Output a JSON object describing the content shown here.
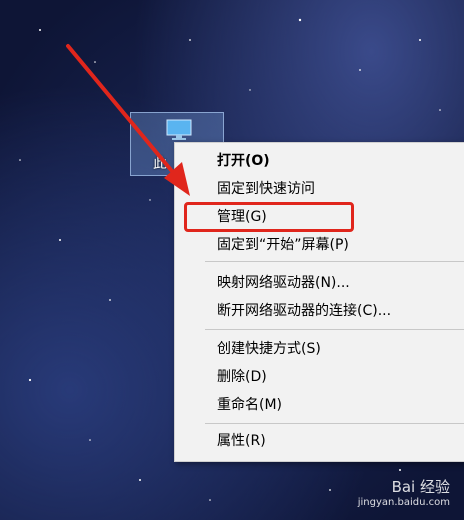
{
  "desktop": {
    "icon_label": "此",
    "icon": "computer-icon"
  },
  "context_menu": {
    "items": [
      {
        "label": "打开(O)",
        "bold": true
      },
      {
        "label": "固定到快速访问"
      },
      {
        "label": "管理(G)",
        "highlighted": true
      },
      {
        "label": "固定到“开始”屏幕(P)"
      },
      {
        "label": "映射网络驱动器(N)..."
      },
      {
        "label": "断开网络驱动器的连接(C)..."
      },
      {
        "label": "创建快捷方式(S)"
      },
      {
        "label": "删除(D)"
      },
      {
        "label": "重命名(M)"
      },
      {
        "label": "属性(R)"
      }
    ]
  },
  "annotation": {
    "arrow_color": "#e0261c",
    "box_color": "#e0261c"
  },
  "watermark": {
    "text": "Bai 经验",
    "sub": "jingyan.baidu.com"
  }
}
